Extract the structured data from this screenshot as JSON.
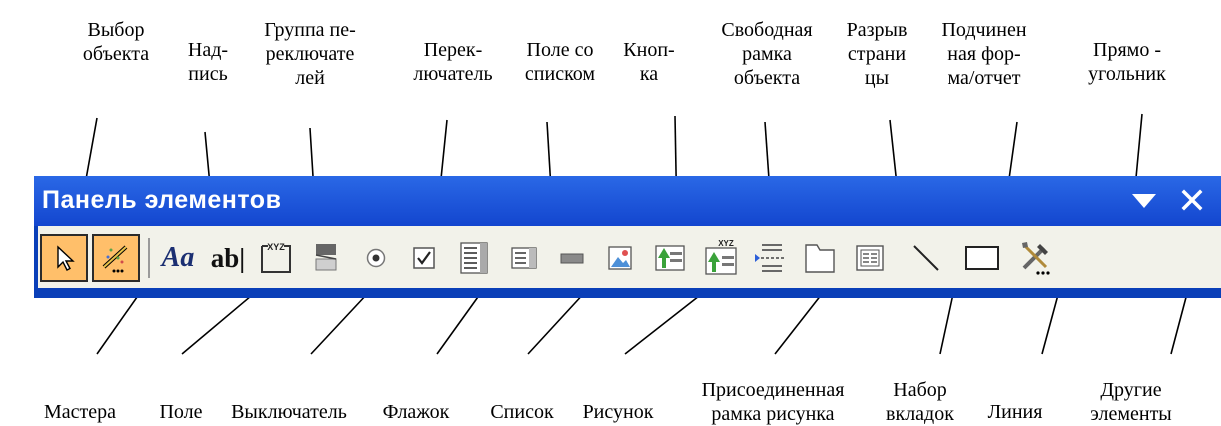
{
  "toolbar": {
    "title": "Панель элементов",
    "menu_icon": "triangle-down-icon",
    "close_label": "×"
  },
  "labels_top": [
    "Выбор\nобъекта",
    "Над-\nпись",
    "Группа пе-\nреключате\nлей",
    "Перек-\nлючатель",
    "Поле со\nсписком",
    "Кноп-\nка",
    "Свободная\nрамка\nобъекта",
    "Разрыв\nстрани\nцы",
    "Подчинен\nная фор-\nма/отчет",
    "Прямо -\nугольник"
  ],
  "labels_bottom": [
    "Мастера",
    "Поле",
    "Выключатель",
    "Флажок",
    "Список",
    "Рисунок",
    "Присоединенная\nрамка рисунка",
    "Набор\nвкладок",
    "Линия",
    "Другие\nэлементы"
  ],
  "tools": [
    {
      "name": "select-objects",
      "icon": "arrow-pointer-icon"
    },
    {
      "name": "control-wizards",
      "icon": "magic-wand-icon"
    },
    {
      "name": "label",
      "icon": "label-aa-icon",
      "text": "Aa"
    },
    {
      "name": "text-box",
      "icon": "textbox-ab-icon",
      "text": "ab|"
    },
    {
      "name": "option-group",
      "icon": "option-group-icon",
      "text": "XYZ"
    },
    {
      "name": "toggle-button",
      "icon": "toggle-button-icon"
    },
    {
      "name": "option-button",
      "icon": "radio-button-icon"
    },
    {
      "name": "check-box",
      "icon": "checkbox-icon"
    },
    {
      "name": "combo-box",
      "icon": "combo-box-icon"
    },
    {
      "name": "list-box",
      "icon": "list-box-icon"
    },
    {
      "name": "command-button",
      "icon": "command-button-icon"
    },
    {
      "name": "image",
      "icon": "image-icon"
    },
    {
      "name": "unbound-object-frame",
      "icon": "unbound-frame-icon"
    },
    {
      "name": "bound-object-frame",
      "icon": "bound-frame-icon",
      "text": "XYZ"
    },
    {
      "name": "page-break",
      "icon": "page-break-icon"
    },
    {
      "name": "tab-control",
      "icon": "tab-control-icon"
    },
    {
      "name": "subform-subreport",
      "icon": "subform-icon"
    },
    {
      "name": "line",
      "icon": "line-icon"
    },
    {
      "name": "rectangle",
      "icon": "rectangle-icon"
    },
    {
      "name": "more-controls",
      "icon": "tools-icon"
    }
  ]
}
